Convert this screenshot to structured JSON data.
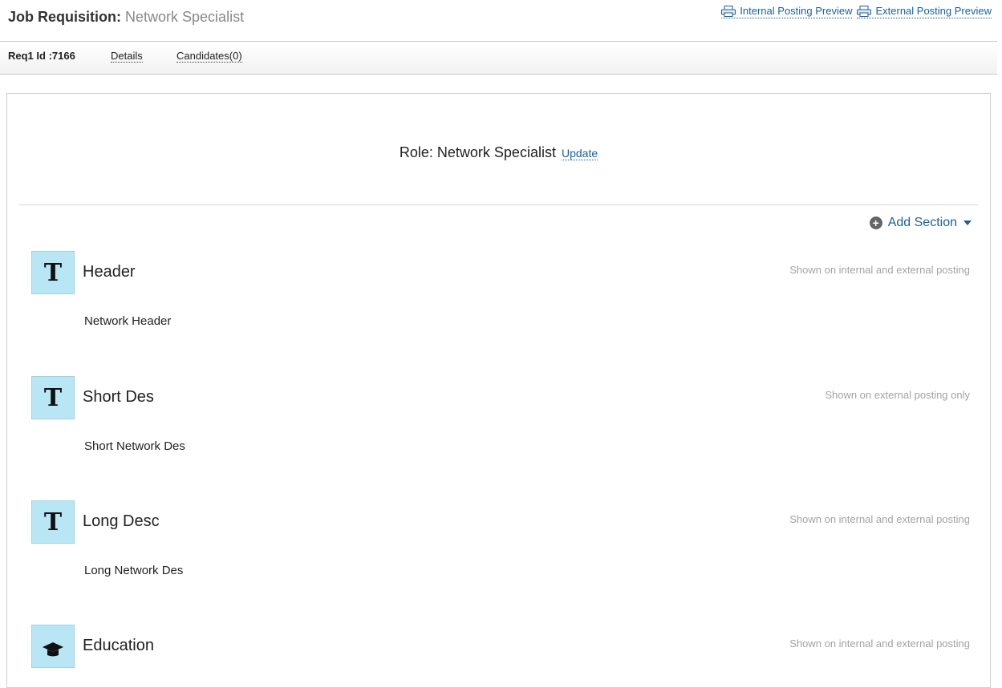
{
  "header": {
    "title_label": "Job Requisition:",
    "title_value": "Network Specialist",
    "internal_preview": "Internal Posting Preview",
    "external_preview": "External Posting Preview"
  },
  "tabs": {
    "req_id": "Req1 Id :7166",
    "details": "Details",
    "candidates": "Candidates(0)"
  },
  "role": {
    "text": "Role: Network Specialist",
    "update": "Update"
  },
  "add_section": "Add Section",
  "sections": [
    {
      "icon": "T",
      "title": "Header",
      "visibility": "Shown on internal and external posting",
      "content": "Network Header"
    },
    {
      "icon": "T",
      "title": "Short Des",
      "visibility": "Shown on external posting only",
      "content": "Short Network Des"
    },
    {
      "icon": "T",
      "title": "Long Desc",
      "visibility": "Shown on internal and external posting",
      "content": "Long Network Des"
    },
    {
      "icon": "graduation-cap",
      "title": "Education",
      "visibility": "Shown on internal and external posting",
      "content": ""
    }
  ]
}
